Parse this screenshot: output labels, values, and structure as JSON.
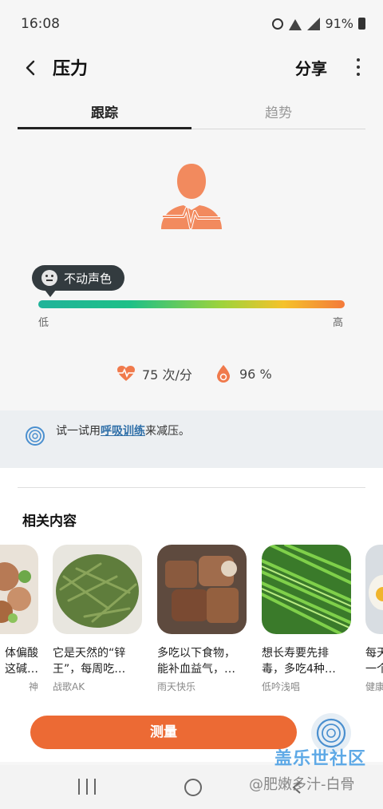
{
  "status_bar": {
    "time": "16:08",
    "battery": "91%"
  },
  "header": {
    "title": "压力",
    "share_label": "分享"
  },
  "tabs": [
    {
      "label": "跟踪",
      "active": true
    },
    {
      "label": "趋势",
      "active": false
    }
  ],
  "stress": {
    "status_label": "不动声色",
    "scale_low": "低",
    "scale_high": "高",
    "heart_rate": "75 次/分",
    "oxygen": "96 %",
    "level_fraction": 0.04
  },
  "tip": {
    "prefix": "试一试用",
    "link": "呼吸训练",
    "suffix": "来减压。"
  },
  "related": {
    "title": "相关内容",
    "items": [
      {
        "caption_line1": "体偏酸",
        "caption_line2": "这碱…",
        "author": "神"
      },
      {
        "caption_line1": "它是天然的“锌",
        "caption_line2": "王”，每周吃…",
        "author": "战歌AK"
      },
      {
        "caption_line1": "多吃以下食物，",
        "caption_line2": "能补血益气，…",
        "author": "雨天快乐"
      },
      {
        "caption_line1": "想长寿要先排",
        "caption_line2": "毒，多吃4种…",
        "author": "低吟浅唱"
      },
      {
        "caption_line1": "每天",
        "caption_line2": "一个",
        "author": "健康"
      }
    ]
  },
  "actions": {
    "measure_label": "测量"
  },
  "watermark": {
    "line1": "盖乐世社区",
    "line2": "@肥嫩多汁-白骨"
  },
  "colors": {
    "accent": "#ec6a34",
    "person": "#f28a5e",
    "tip_bg": "#eceff2",
    "link": "#2f6fa8"
  }
}
